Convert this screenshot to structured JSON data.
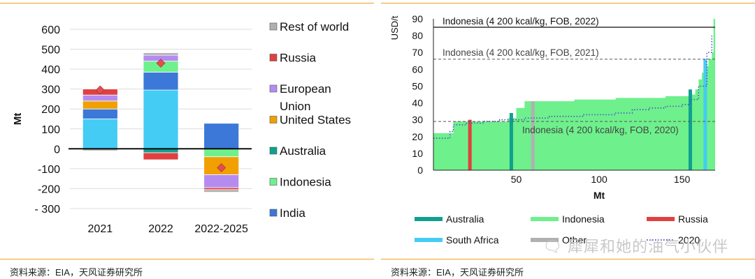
{
  "left_chart": {
    "source": "资料来源：EIA，天风证券研究所",
    "chart_data": {
      "type": "bar",
      "stacked": true,
      "ylabel": "Mt",
      "ylim": [
        -300,
        600
      ],
      "yticks": [
        -300,
        -200,
        -100,
        0,
        100,
        200,
        300,
        400,
        500,
        600
      ],
      "ytick_labels": [
        "- 300",
        "-200",
        "-100",
        "0",
        "100",
        "200",
        "300",
        "400",
        "500",
        "600"
      ],
      "categories": [
        "2021",
        "2022",
        "2022-2025"
      ],
      "legend_position": "right",
      "series": [
        {
          "name": "Rest of world",
          "color": "#b0b0b0",
          "values": [
            -10,
            12,
            -13
          ]
        },
        {
          "name": "Russia",
          "color": "#e04040",
          "values": [
            30,
            -35,
            -10
          ]
        },
        {
          "name": "European Union",
          "color": "#b48cf0",
          "values": [
            30,
            30,
            -65
          ]
        },
        {
          "name": "United States",
          "color": "#f0a000",
          "values": [
            40,
            0,
            -90
          ]
        },
        {
          "name": "Australia",
          "color": "#10a090",
          "values": [
            0,
            -20,
            0
          ]
        },
        {
          "name": "Indonesia",
          "color": "#6ef08c",
          "values": [
            0,
            55,
            -40
          ]
        },
        {
          "name": "India",
          "color": "#3c78d8",
          "values": [
            50,
            90,
            128
          ]
        },
        {
          "name": "",
          "color": "#44ccf4",
          "values": [
            150,
            295,
            0
          ]
        }
      ],
      "totals": [
        295,
        430,
        -95
      ],
      "total_marker_color": "#e05050"
    }
  },
  "right_chart": {
    "source": "资料来源：EIA，天风证券研究所",
    "watermark": "🗨 犀犀和她的油气小伙伴",
    "chart_data": {
      "type": "area",
      "xlabel": "Mt",
      "ylabel": "USD/t",
      "xlim": [
        0,
        170
      ],
      "ylim": [
        0,
        90
      ],
      "xticks": [
        50,
        100,
        150
      ],
      "yticks": [
        0,
        10,
        20,
        30,
        40,
        50,
        60,
        70,
        80,
        90
      ],
      "supply_curve": {
        "color": "#6ef08c",
        "x": [
          0,
          10,
          12,
          45,
          50,
          55,
          85,
          110,
          140,
          155,
          158,
          160,
          162,
          164,
          166,
          168,
          169,
          170
        ],
        "y": [
          22,
          22,
          29,
          31,
          37,
          41,
          42,
          43,
          44,
          45,
          48,
          54,
          58,
          62,
          66,
          70,
          90,
          90
        ]
      },
      "dotted_curve": {
        "color": "#5050d0",
        "x": [
          0,
          8,
          10,
          12,
          20,
          30,
          40,
          55,
          70,
          90,
          110,
          120,
          130,
          140,
          150,
          155,
          160,
          165,
          168
        ],
        "y": [
          19,
          19,
          23,
          27,
          28,
          29,
          30,
          31,
          32,
          33,
          34,
          36,
          37,
          38,
          39,
          42,
          50,
          70,
          80
        ]
      },
      "reference_lines": [
        {
          "label": "Indonesia (4 200 kcal/kg, FOB, 2022)",
          "y": 85,
          "style": "solid",
          "color": "#222222"
        },
        {
          "label": "Indonesia (4 200 kcal/kg, FOB, 2021)",
          "y": 66,
          "style": "dashed",
          "color": "#555555"
        },
        {
          "label": "Indonesia (4 200 kcal/kg, FOB, 2020)",
          "y": 29,
          "style": "dashed",
          "color": "#555555"
        }
      ],
      "highlight_bars": [
        {
          "name": "Russia",
          "x": 22,
          "top": 30,
          "color": "#e04040"
        },
        {
          "name": "Australia",
          "x": 47,
          "top": 34,
          "color": "#10a090"
        },
        {
          "name": "Other",
          "x": 60,
          "top": 41,
          "color": "#b0b0b0"
        },
        {
          "name": "Australia",
          "x": 155,
          "top": 48,
          "color": "#10a090"
        },
        {
          "name": "South Africa",
          "x": 164,
          "top": 66,
          "color": "#44ccf4"
        }
      ],
      "legend": [
        {
          "name": "Australia",
          "color": "#10a090"
        },
        {
          "name": "Indonesia",
          "color": "#6ef08c"
        },
        {
          "name": "Russia",
          "color": "#e04040"
        },
        {
          "name": "South Africa",
          "color": "#44ccf4"
        },
        {
          "name": "Other",
          "color": "#b0b0b0"
        },
        {
          "name": "2020",
          "color": "#5050d0"
        }
      ]
    }
  }
}
